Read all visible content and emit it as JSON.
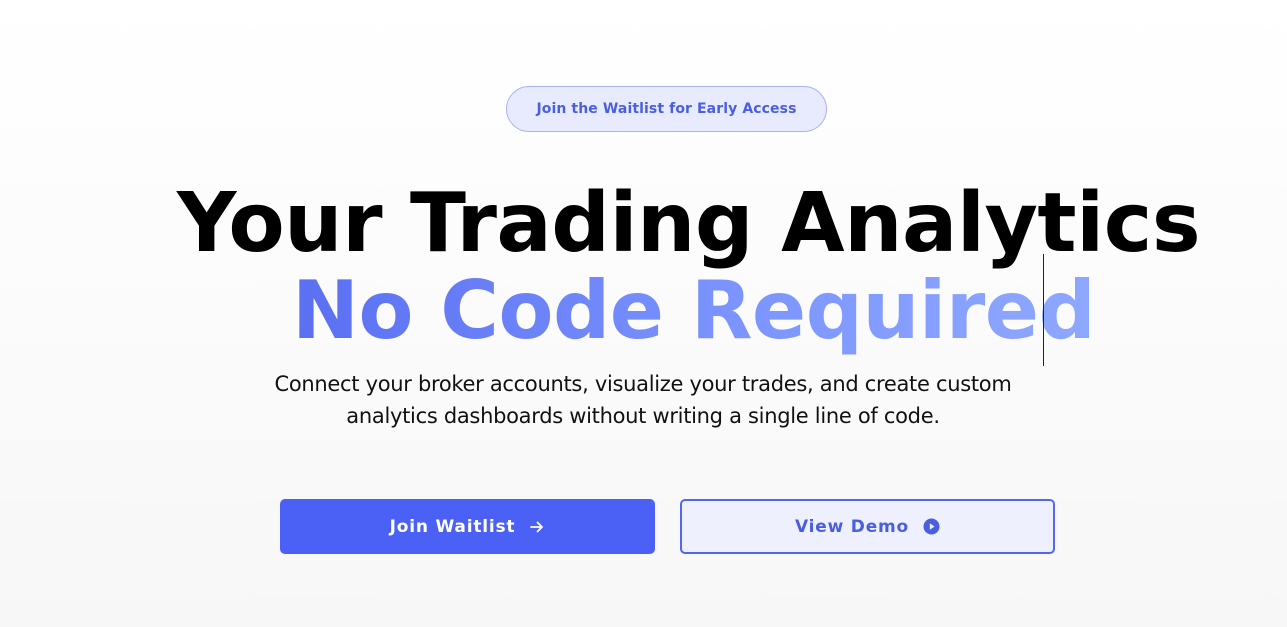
{
  "badge": {
    "label": "Join the Waitlist for Early Access"
  },
  "hero": {
    "headline_line1": "Your Trading Analytics",
    "headline_line2": "No Code Required",
    "subtitle_line1": "Connect your broker accounts, visualize your trades, and create custom",
    "subtitle_line2": "analytics dashboards without writing a single line of code."
  },
  "actions": {
    "primary": {
      "label": "Join Waitlist",
      "icon": "arrow-right-icon"
    },
    "secondary": {
      "label": "View Demo",
      "icon": "play-circle-icon"
    }
  },
  "colors": {
    "accent": "#4b61f6",
    "accent_light": "#e8ebfd",
    "gradient_start": "#5a6ff2",
    "gradient_end": "#8ea8ff",
    "headline": "#000000",
    "body_text": "#111111"
  }
}
